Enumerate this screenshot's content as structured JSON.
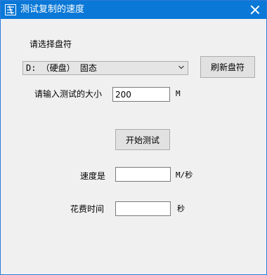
{
  "window": {
    "title": "测试复制的速度"
  },
  "drive": {
    "prompt": "请选择盘符",
    "selected": "D: （硬盘） 固态",
    "refresh_label": "刷新盘符"
  },
  "test_size": {
    "label": "请输入测试的大小",
    "value": "200",
    "unit": "M"
  },
  "start_label": "开始测试",
  "speed": {
    "label": "速度是",
    "value": "",
    "unit": "M/秒"
  },
  "elapsed": {
    "label": "花费时间",
    "value": "",
    "unit": "秒"
  },
  "colors": {
    "titlebar": "#0a78d7",
    "window_bg": "#f0f0f0"
  },
  "icons": [
    "app-icon",
    "close-icon",
    "chevron-down-icon"
  ]
}
